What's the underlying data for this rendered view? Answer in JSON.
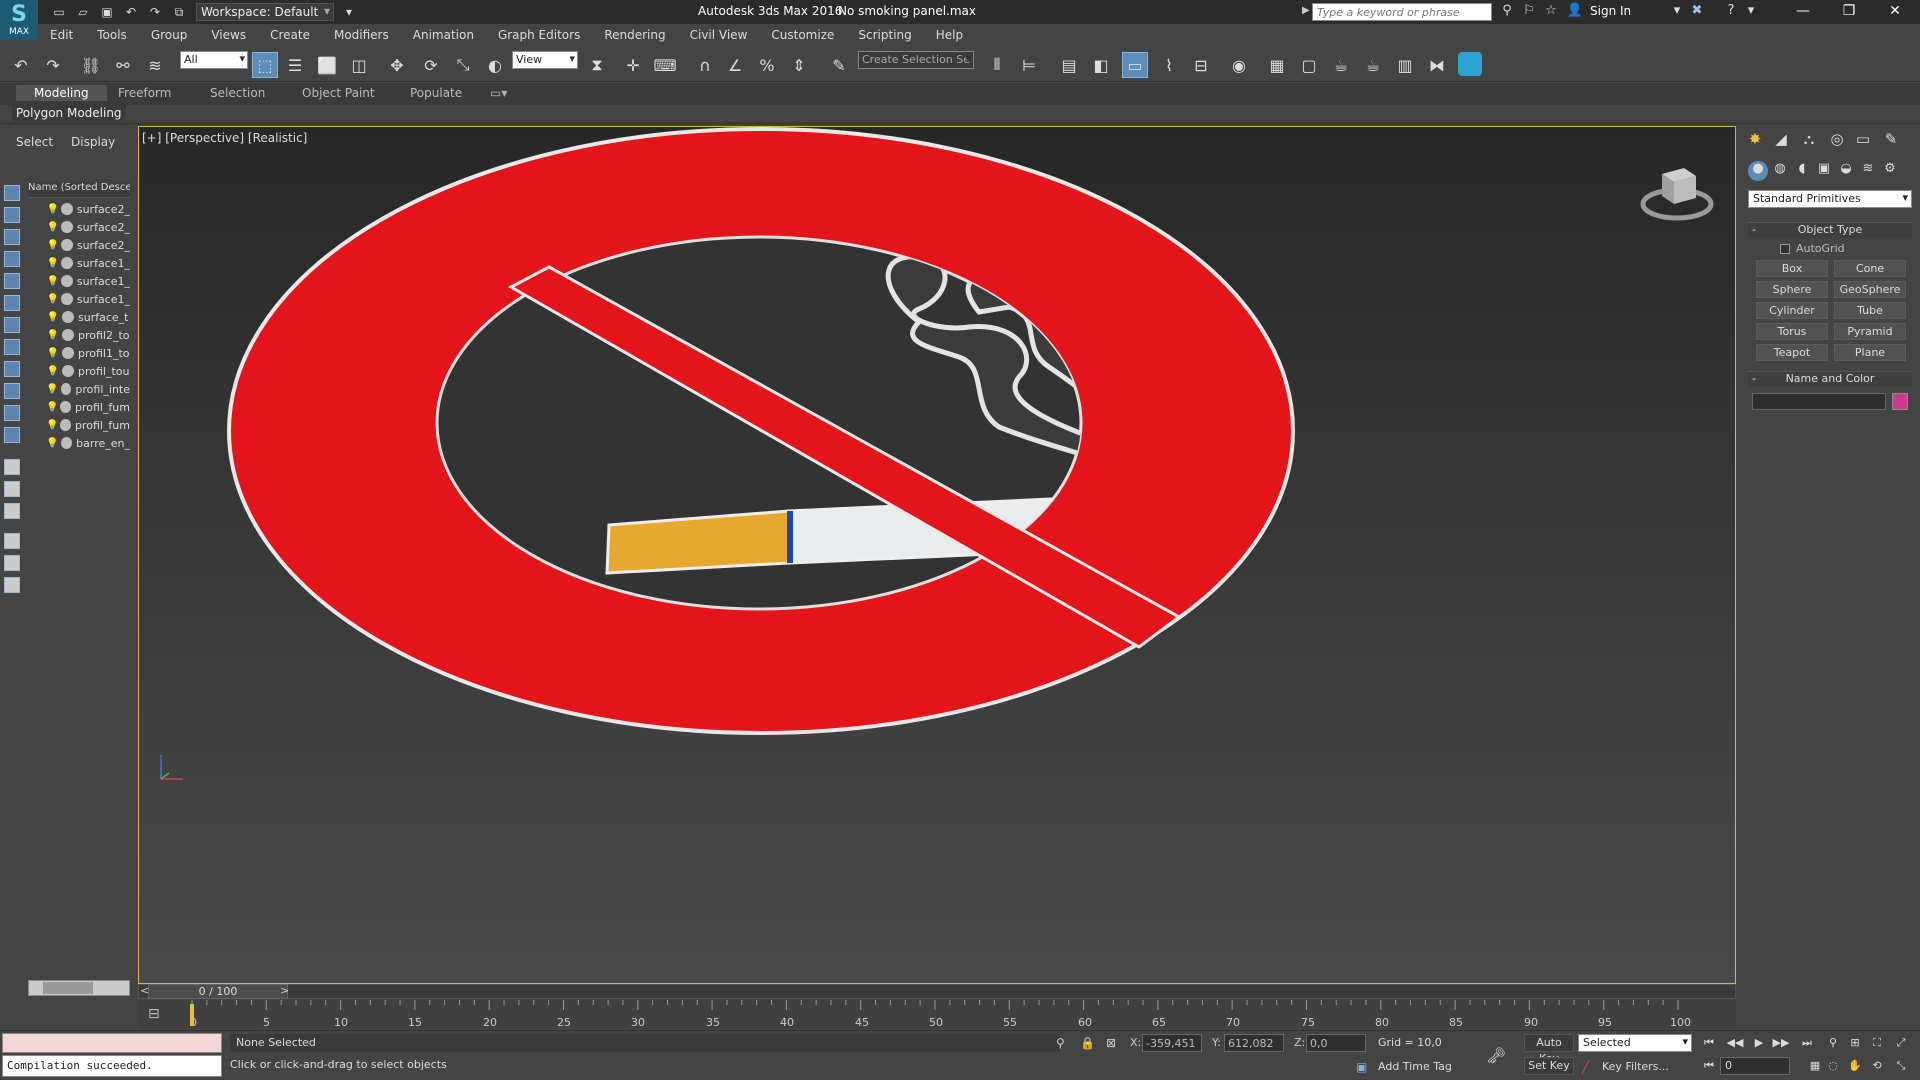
{
  "titlebar": {
    "logo": "MAX",
    "workspace": "Workspace: Default",
    "app_title": "Autodesk 3ds Max 2016",
    "file_name": "No smoking panel.max",
    "search_placeholder": "Type a keyword or phrase",
    "sign_in": "Sign In"
  },
  "menu": [
    "Edit",
    "Tools",
    "Group",
    "Views",
    "Create",
    "Modifiers",
    "Animation",
    "Graph Editors",
    "Rendering",
    "Civil View",
    "Customize",
    "Scripting",
    "Help"
  ],
  "toolbar": {
    "selection_filter": "All",
    "ref_coord": "View",
    "selection_set": "Create Selection Se"
  },
  "ribbon": {
    "tabs": [
      "Modeling",
      "Freeform",
      "Selection",
      "Object Paint",
      "Populate"
    ],
    "active_tab": "Modeling",
    "panel_label": "Polygon Modeling"
  },
  "scene_explorer": {
    "tabs": [
      "Select",
      "Display"
    ],
    "column_header": "Name (Sorted Desce",
    "items": [
      "surface2_",
      "surface2_",
      "surface2_",
      "surface1_",
      "surface1_",
      "surface1_",
      "surface_t",
      "profil2_to",
      "profil1_to",
      "profil_tou",
      "profil_inte",
      "profil_fum",
      "profil_fum",
      "barre_en_"
    ]
  },
  "viewport": {
    "label": "[+] [Perspective] [Realistic]",
    "sign_colors": {
      "ring": "#e3141a",
      "background": "#333333",
      "filter": "#e8a830",
      "paper": "#e8ecef",
      "band": "#1a4ab0"
    }
  },
  "command_panel": {
    "primitives_dropdown": "Standard Primitives",
    "object_type_title": "Object Type",
    "autogrid": "AutoGrid",
    "buttons": [
      "Box",
      "Cone",
      "Sphere",
      "GeoSphere",
      "Cylinder",
      "Tube",
      "Torus",
      "Pyramid",
      "Teapot",
      "Plane"
    ],
    "name_color_title": "Name and Color",
    "object_color": "#d03a8e"
  },
  "timeline": {
    "slider_label": "0 / 100",
    "ticks": [
      "0",
      "5",
      "10",
      "15",
      "20",
      "25",
      "30",
      "35",
      "40",
      "45",
      "50",
      "55",
      "60",
      "65",
      "70",
      "75",
      "80",
      "85",
      "90",
      "95",
      "100"
    ]
  },
  "status": {
    "maxscript_output": "Compilation succeeded.",
    "selection_status": "None Selected",
    "prompt": "Click or click-and-drag to select objects",
    "x_label": "X:",
    "x_value": "-359,451",
    "y_label": "Y:",
    "y_value": "612,082",
    "z_label": "Z:",
    "z_value": "0,0",
    "grid": "Grid = 10,0",
    "add_time_tag": "Add Time Tag",
    "auto_key": "Auto Key",
    "set_key": "Set Key",
    "key_mode": "Selected",
    "key_filters": "Key Filters...",
    "frame": "0"
  }
}
